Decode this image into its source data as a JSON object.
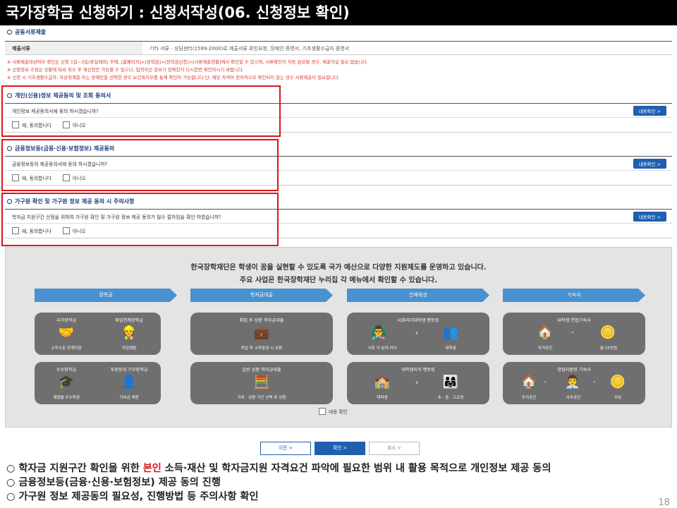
{
  "title": "국가장학금 신청하기 : 신청서작성(06. 신청정보 확인)",
  "documents": {
    "heading": "공동서류제출",
    "label": "제출서류",
    "value": "기타 서류 - 상담센터(1599-2000)로 제출서류 확인요청, 장애인 증명서, 기초생활수급자 증명서"
  },
  "notes": [
    "※ 서류제출대상여부 확인은 신청 1일~3일(휴일제외) 후에, [홈페이지]>[장학금]>[장학금신청]>[서류제출현황]에서 확인할 수 있으며, 서류확인이 자동 완료될 경우, 제출하실 필요 없습니다.",
    "※ 신청정보 수정은 상황에 따라 취소 후 재신청만 가능할 수 있으나, 입력하신 정보가 정확한지 다시한번 확인하시기 바랍니다.",
    "※ 신청 시 기초생활수급자, 차상위계층 또는 장애인을 선택한 경우 보건복지부를 통해 확인이 가능합니다.단, 해당 자격이 전자적으로 확인되지 않는 경우 서류제출이 필요합니다."
  ],
  "agreements": [
    {
      "heading": "개인(신용)정보 제공동의 및 조회 동의서",
      "question": "개인정보 제공동의서에 동의 하시겠습니까?",
      "detail_button": "내용확인 >",
      "yes": "예, 동의합니다",
      "no": "아니오"
    },
    {
      "heading": "금융정보등(금융·신용·보험정보) 제공동의",
      "question": "금융정보등의 제공동의서에 동의 하시겠습니까?",
      "detail_button": "내용확인 >",
      "yes": "예, 동의합니다",
      "no": "아니오"
    },
    {
      "heading": "가구원 확인 및 가구원 정보 제공 동의 시 주의사항",
      "question": "학자금 지원구간 산정을 위하여 가구원 확인 및 가구원 정보 제공 동의가 필수 절차임을 확인 하였습니까?",
      "detail_button": "내용확인 >",
      "yes": "예, 동의합니다",
      "no": "아니오"
    }
  ],
  "info": {
    "line1": "한국장학재단은 학생이 꿈을 실현할 수 있도록 국가 예산으로 다양한 지원제도를 운영하고 있습니다.",
    "line2": "주요 사업은 한국장학재단 누리집 각 메뉴에서 확인할 수 있습니다.",
    "categories": [
      "장학금",
      "학자금대출",
      "인재육성",
      "기숙사"
    ],
    "panels": {
      "p1": {
        "t1": "국가장학금",
        "t2": "취업연계장학금",
        "b1": "소득수준 연계지원",
        "b2": "직업체험"
      },
      "p2": {
        "t1": "취업 후 상환 학자금대출",
        "b1": "취업 후 소득발생 시 상환"
      },
      "p3": {
        "t1": "사회리더대학생 멘토링",
        "b1": "사회 각 분야 리더",
        "b2": "대학생"
      },
      "p4": {
        "t1": "대학생 연합기숙사",
        "b1": "주거공간",
        "b2": "월 15만원"
      },
      "p5": {
        "t1": "우수장학금",
        "t2": "푸른등대 기부장학금",
        "b1": "계열별 우수학생",
        "b2": "기부금 재원"
      },
      "p6": {
        "t1": "일반 상환 학자금대출",
        "b1": "거치 · 상환 기간 선택 후 상환"
      },
      "p7": {
        "t1": "대학생지식 멘토링",
        "b1": "대학생",
        "b2": "초 · 중 · 고교생"
      },
      "p8": {
        "t1": "창업지원형 기숙사",
        "b1": "주거공간",
        "b2": "사무공간",
        "b3": "무상"
      }
    },
    "confirm_label": "내용 확인"
  },
  "nav": {
    "prev": "이전 >",
    "confirm": "확인 >",
    "cancel": "취소 >"
  },
  "bottom": {
    "b1_pre": "○ 학자금 지원구간 확인을 위한 ",
    "b1_red": "본인",
    "b1_post": " 소득·재산 및 학자금지원 자격요건 파악에 필요한 범위 내 활용 목적으로 개인정보 제공 동의",
    "b2": "○ 금융정보등(금융·신용·보험정보) 제공 동의 진행",
    "b3": "○ 가구원 정보 제공동의 필요성, 진행방법 등 주의사항 확인",
    "page": "18"
  }
}
